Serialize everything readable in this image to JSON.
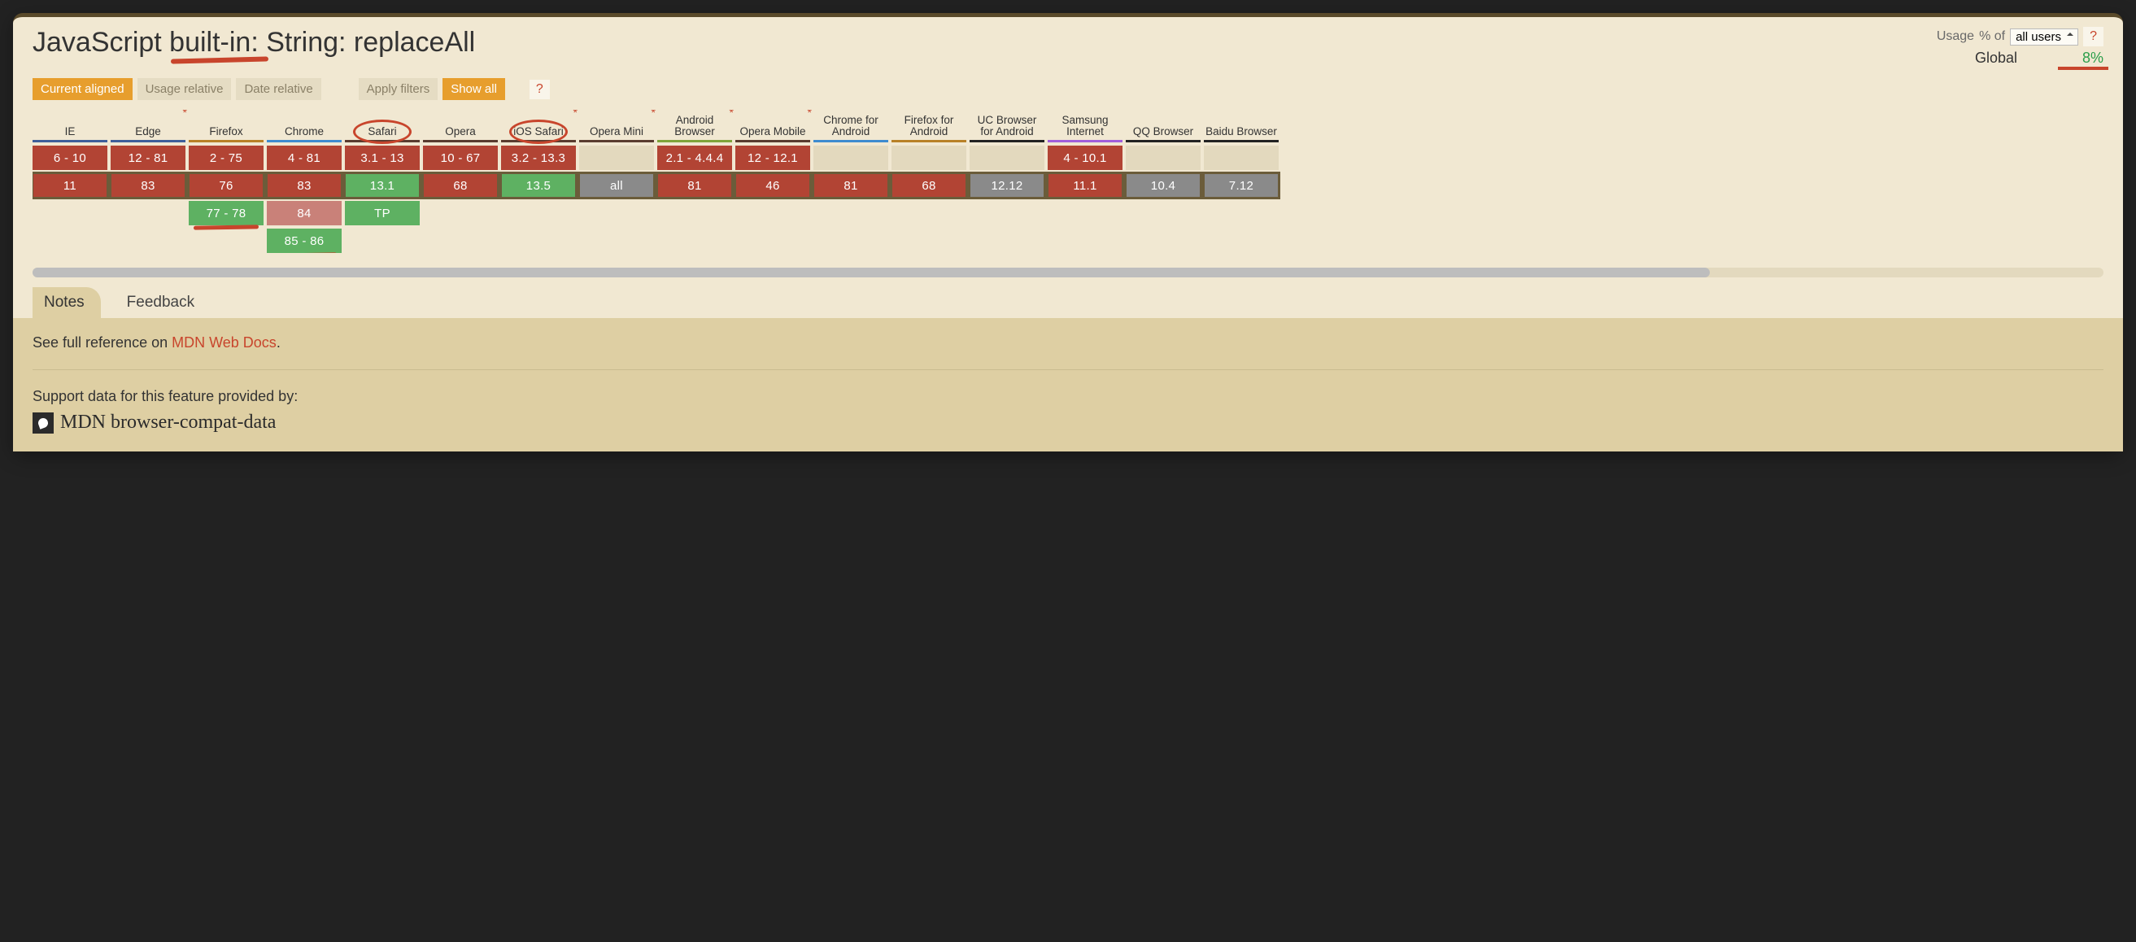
{
  "title": "JavaScript built-in: String: replaceAll",
  "usage": {
    "label_prefix": "Usage",
    "label_suffix": "% of",
    "select_value": "all users",
    "help": "?"
  },
  "global": {
    "label": "Global",
    "percent": "8%"
  },
  "filters": {
    "current_aligned": "Current aligned",
    "usage_relative": "Usage relative",
    "date_relative": "Date relative",
    "apply_filters": "Apply filters",
    "show_all": "Show all",
    "help": "?"
  },
  "colors": {
    "no": "#b24434",
    "yes": "#5eb162",
    "partial": "#c98179",
    "unknown": "#8a8a8a",
    "empty": "#e3d9be"
  },
  "browsers": [
    {
      "name": "IE",
      "bar": "#3e5f9a",
      "asterisk": false,
      "rows": [
        {
          "v": "6 - 10",
          "s": "no"
        },
        {
          "v": "11",
          "s": "no"
        }
      ]
    },
    {
      "name": "Edge",
      "bar": "#3e5f9a",
      "asterisk": true,
      "rows": [
        {
          "v": "12 - 81",
          "s": "no"
        },
        {
          "v": "83",
          "s": "no"
        }
      ]
    },
    {
      "name": "Firefox",
      "bar": "#b88127",
      "asterisk": false,
      "rows": [
        {
          "v": "2 - 75",
          "s": "no"
        },
        {
          "v": "76",
          "s": "no"
        },
        {
          "v": "77 - 78",
          "s": "yes",
          "underline": true
        }
      ]
    },
    {
      "name": "Chrome",
      "bar": "#3e8bcf",
      "asterisk": false,
      "rows": [
        {
          "v": "4 - 81",
          "s": "no"
        },
        {
          "v": "83",
          "s": "no"
        },
        {
          "v": "84",
          "s": "partial"
        },
        {
          "v": "85 - 86",
          "s": "yes",
          "underline": true
        }
      ]
    },
    {
      "name": "Safari",
      "bar": "#5a3c2f",
      "asterisk": false,
      "circled": true,
      "rows": [
        {
          "v": "3.1 - 13",
          "s": "no"
        },
        {
          "v": "13.1",
          "s": "yes"
        },
        {
          "v": "TP",
          "s": "yes"
        }
      ]
    },
    {
      "name": "Opera",
      "bar": "#5a3c2f",
      "asterisk": false,
      "rows": [
        {
          "v": "10 - 67",
          "s": "no"
        },
        {
          "v": "68",
          "s": "no"
        }
      ]
    },
    {
      "name": "iOS Safari",
      "bar": "#5a3c2f",
      "asterisk": true,
      "circled": true,
      "rows": [
        {
          "v": "3.2 - 13.3",
          "s": "no"
        },
        {
          "v": "13.5",
          "s": "yes"
        }
      ]
    },
    {
      "name": "Opera Mini",
      "bar": "#5a3c2f",
      "asterisk": true,
      "rows": [
        {
          "v": "",
          "s": ""
        },
        {
          "v": "all",
          "s": "unknown"
        }
      ]
    },
    {
      "name": "Android Browser",
      "bar": "#7fa43a",
      "asterisk": true,
      "rows": [
        {
          "v": "2.1 - 4.4.4",
          "s": "no"
        },
        {
          "v": "81",
          "s": "no"
        }
      ]
    },
    {
      "name": "Opera Mobile",
      "bar": "#5a3c2f",
      "asterisk": true,
      "rows": [
        {
          "v": "12 - 12.1",
          "s": "no"
        },
        {
          "v": "46",
          "s": "no"
        }
      ]
    },
    {
      "name": "Chrome for Android",
      "bar": "#3e8bcf",
      "asterisk": false,
      "rows": [
        {
          "v": "",
          "s": ""
        },
        {
          "v": "81",
          "s": "no"
        }
      ]
    },
    {
      "name": "Firefox for Android",
      "bar": "#b88127",
      "asterisk": false,
      "rows": [
        {
          "v": "",
          "s": ""
        },
        {
          "v": "68",
          "s": "no"
        }
      ]
    },
    {
      "name": "UC Browser for Android",
      "bar": "#222",
      "asterisk": false,
      "rows": [
        {
          "v": "",
          "s": ""
        },
        {
          "v": "12.12",
          "s": "unknown"
        }
      ]
    },
    {
      "name": "Samsung Internet",
      "bar": "#a15fdc",
      "asterisk": false,
      "rows": [
        {
          "v": "4 - 10.1",
          "s": "no"
        },
        {
          "v": "11.1",
          "s": "no"
        }
      ]
    },
    {
      "name": "QQ Browser",
      "bar": "#222",
      "asterisk": false,
      "rows": [
        {
          "v": "",
          "s": ""
        },
        {
          "v": "10.4",
          "s": "unknown"
        }
      ]
    },
    {
      "name": "Baidu Browser",
      "bar": "#222",
      "asterisk": false,
      "rows": [
        {
          "v": "",
          "s": ""
        },
        {
          "v": "7.12",
          "s": "unknown"
        }
      ]
    }
  ],
  "tabs": {
    "notes": "Notes",
    "feedback": "Feedback"
  },
  "notes": {
    "reference_prefix": "See full reference on ",
    "reference_link": "MDN Web Docs",
    "reference_suffix": ".",
    "source_line": "Support data for this feature provided by:",
    "source_brand": "MDN browser-compat-data"
  }
}
